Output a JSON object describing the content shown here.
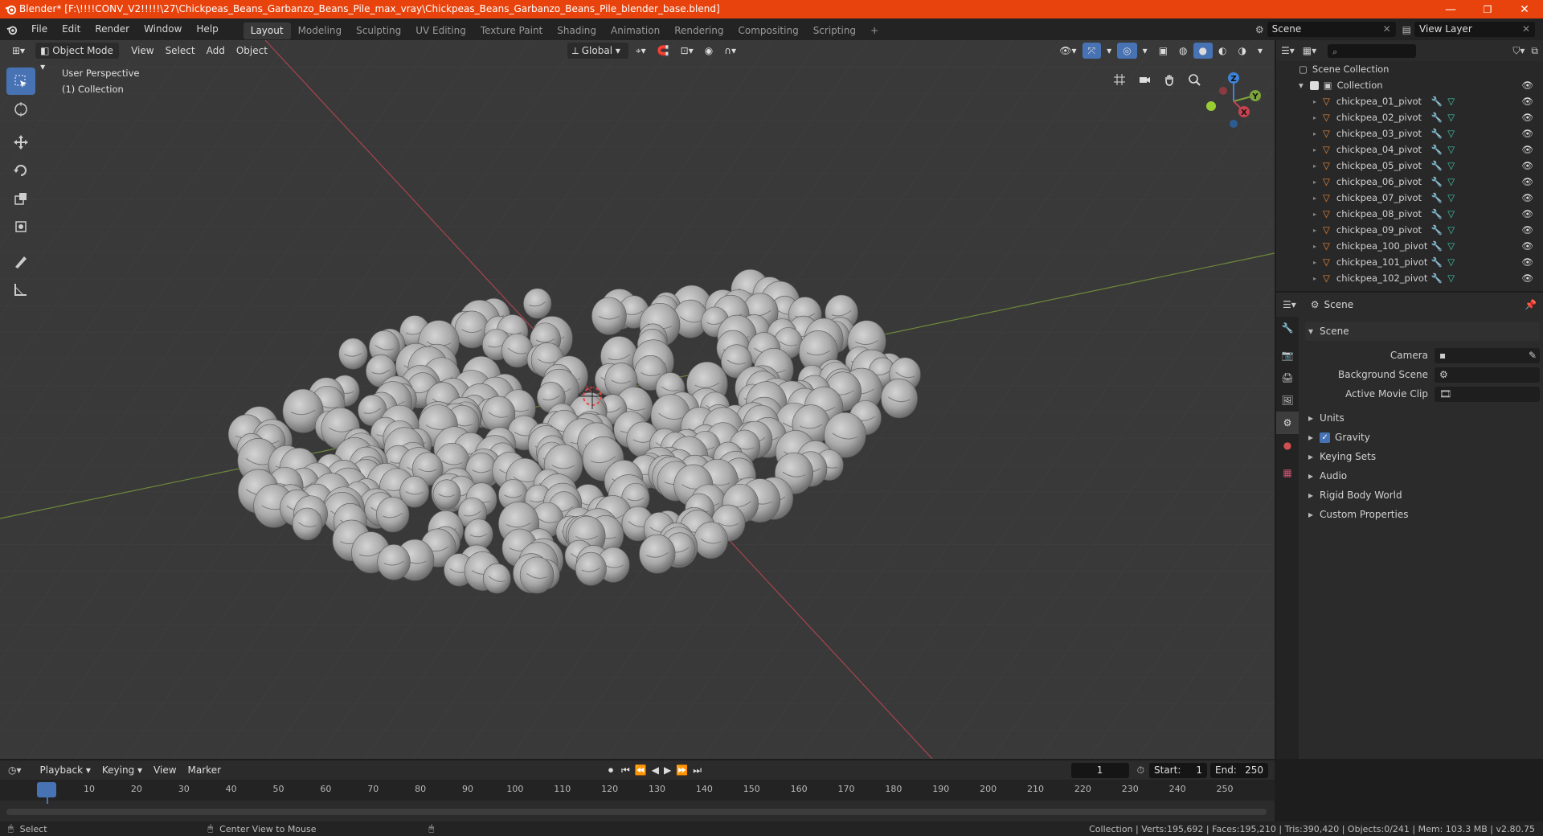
{
  "window": {
    "title": "Blender* [F:\\!!!!CONV_V2!!!!!\\27\\Chickpeas_Beans_Garbanzo_Beans_Pile_max_vray\\Chickpeas_Beans_Garbanzo_Beans_Pile_blender_base.blend]",
    "minimize": "—",
    "maximize": "❐",
    "close": "✕"
  },
  "menu": {
    "items": [
      "File",
      "Edit",
      "Render",
      "Window",
      "Help"
    ],
    "workspaces": [
      "Layout",
      "Modeling",
      "Sculpting",
      "UV Editing",
      "Texture Paint",
      "Shading",
      "Animation",
      "Rendering",
      "Compositing",
      "Scripting"
    ],
    "add_tab": "+",
    "scene_label": "Scene",
    "view_layer_label": "View Layer"
  },
  "viewport": {
    "mode": "Object Mode",
    "menus": [
      "View",
      "Select",
      "Add",
      "Object"
    ],
    "transform_orientation": "Global",
    "perspective": "User Perspective",
    "collection": "(1) Collection",
    "gizmo": {
      "z": "Z",
      "y": "Y",
      "x": "X"
    }
  },
  "outliner": {
    "search_placeholder": "",
    "root": "Scene Collection",
    "collection": "Collection",
    "objects": [
      "chickpea_01_pivot",
      "chickpea_02_pivot",
      "chickpea_03_pivot",
      "chickpea_04_pivot",
      "chickpea_05_pivot",
      "chickpea_06_pivot",
      "chickpea_07_pivot",
      "chickpea_08_pivot",
      "chickpea_09_pivot",
      "chickpea_100_pivot",
      "chickpea_101_pivot",
      "chickpea_102_pivot"
    ]
  },
  "properties": {
    "context": "Scene",
    "section": "Scene",
    "fields": {
      "camera": "Camera",
      "background_scene": "Background Scene",
      "active_movie_clip": "Active Movie Clip"
    },
    "panels": [
      "Units",
      "Gravity",
      "Keying Sets",
      "Audio",
      "Rigid Body World",
      "Custom Properties"
    ],
    "gravity_checked": true
  },
  "timeline": {
    "menus": [
      "Playback",
      "Keying",
      "View",
      "Marker"
    ],
    "current_frame": "1",
    "start_label": "Start:",
    "start": "1",
    "end_label": "End:",
    "end": "250",
    "ticks": [
      "1",
      "10",
      "20",
      "30",
      "40",
      "50",
      "60",
      "70",
      "80",
      "90",
      "100",
      "110",
      "120",
      "130",
      "140",
      "150",
      "160",
      "170",
      "180",
      "190",
      "200",
      "210",
      "220",
      "230",
      "240",
      "250"
    ]
  },
  "status": {
    "left_action": "Select",
    "mid_action": "Center View to Mouse",
    "stats": "Collection | Verts:195,692 | Faces:195,210 | Tris:390,420 | Objects:0/241 | Mem: 103.3 MB | v2.80.75"
  },
  "colors": {
    "titlebar": "#e8430d",
    "accent": "#4772b3",
    "x_axis": "#c8434f",
    "y_axis": "#7fa33c",
    "z_axis": "#3f83d6",
    "mesh_icon": "#e8893b",
    "modifier_icon": "#6fa6e0",
    "mesh_data_icon": "#3fc6a7"
  }
}
